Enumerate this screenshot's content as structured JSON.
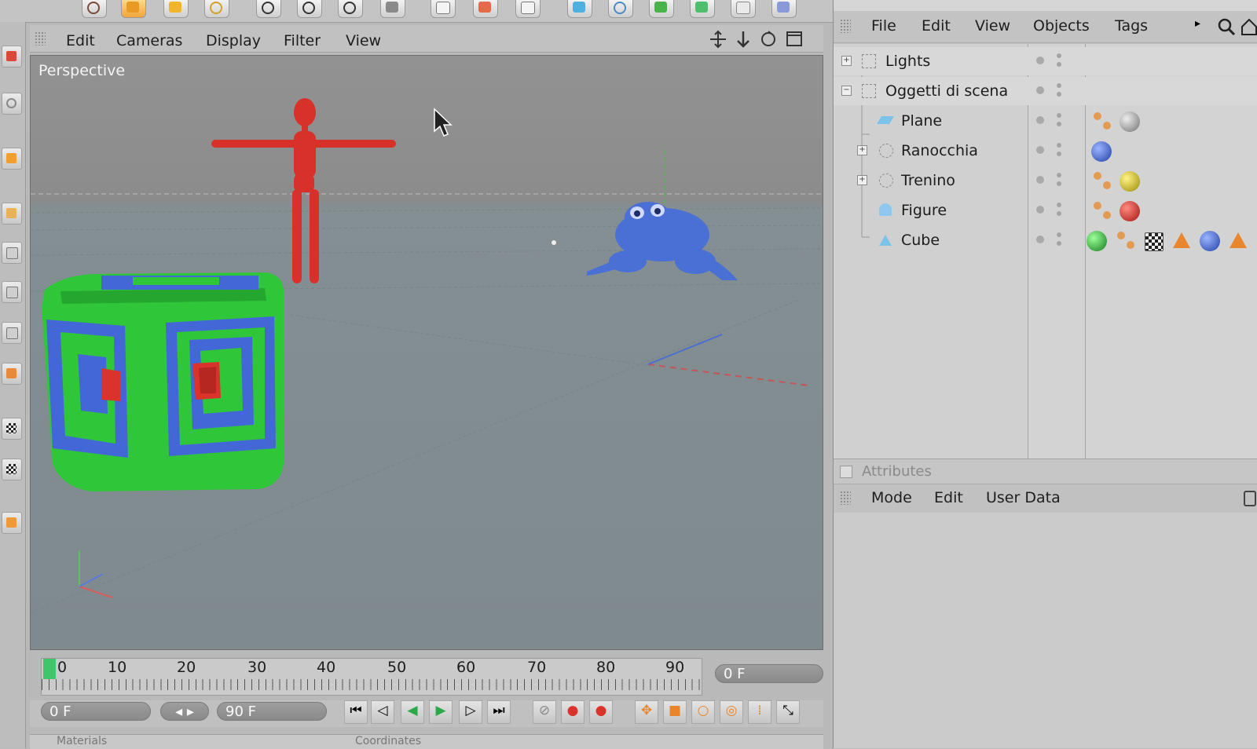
{
  "viewport": {
    "menu": [
      "Edit",
      "Cameras",
      "Display",
      "Filter",
      "View"
    ],
    "label": "Perspective"
  },
  "timeline": {
    "ticks": [
      "0",
      "10",
      "20",
      "30",
      "40",
      "50",
      "60",
      "70",
      "80",
      "90"
    ],
    "current_frame": "0 F"
  },
  "transport": {
    "start_field": "0 F",
    "end_field": "90 F"
  },
  "object_manager": {
    "menu": [
      "File",
      "Edit",
      "View",
      "Objects",
      "Tags"
    ],
    "objects": [
      {
        "name": "Lights",
        "level": 0,
        "expander": "+"
      },
      {
        "name": "Oggetti di scena",
        "level": 0,
        "expander": "−"
      },
      {
        "name": "Plane",
        "level": 1,
        "expander": ""
      },
      {
        "name": "Ranocchia",
        "level": 1,
        "expander": "+"
      },
      {
        "name": "Trenino",
        "level": 1,
        "expander": "+"
      },
      {
        "name": "Figure",
        "level": 1,
        "expander": ""
      },
      {
        "name": "Cube",
        "level": 1,
        "expander": ""
      }
    ]
  },
  "attributes": {
    "title": "Attributes",
    "menu": [
      "Mode",
      "Edit",
      "User Data"
    ]
  },
  "bottom_panels": [
    "Materials",
    "Coordinates"
  ],
  "colors": {
    "figure": "#d8312a",
    "frog": "#4a70d6",
    "cube_green": "#2fc63a",
    "cube_blue": "#4467d8",
    "cube_red": "#d9332b"
  }
}
